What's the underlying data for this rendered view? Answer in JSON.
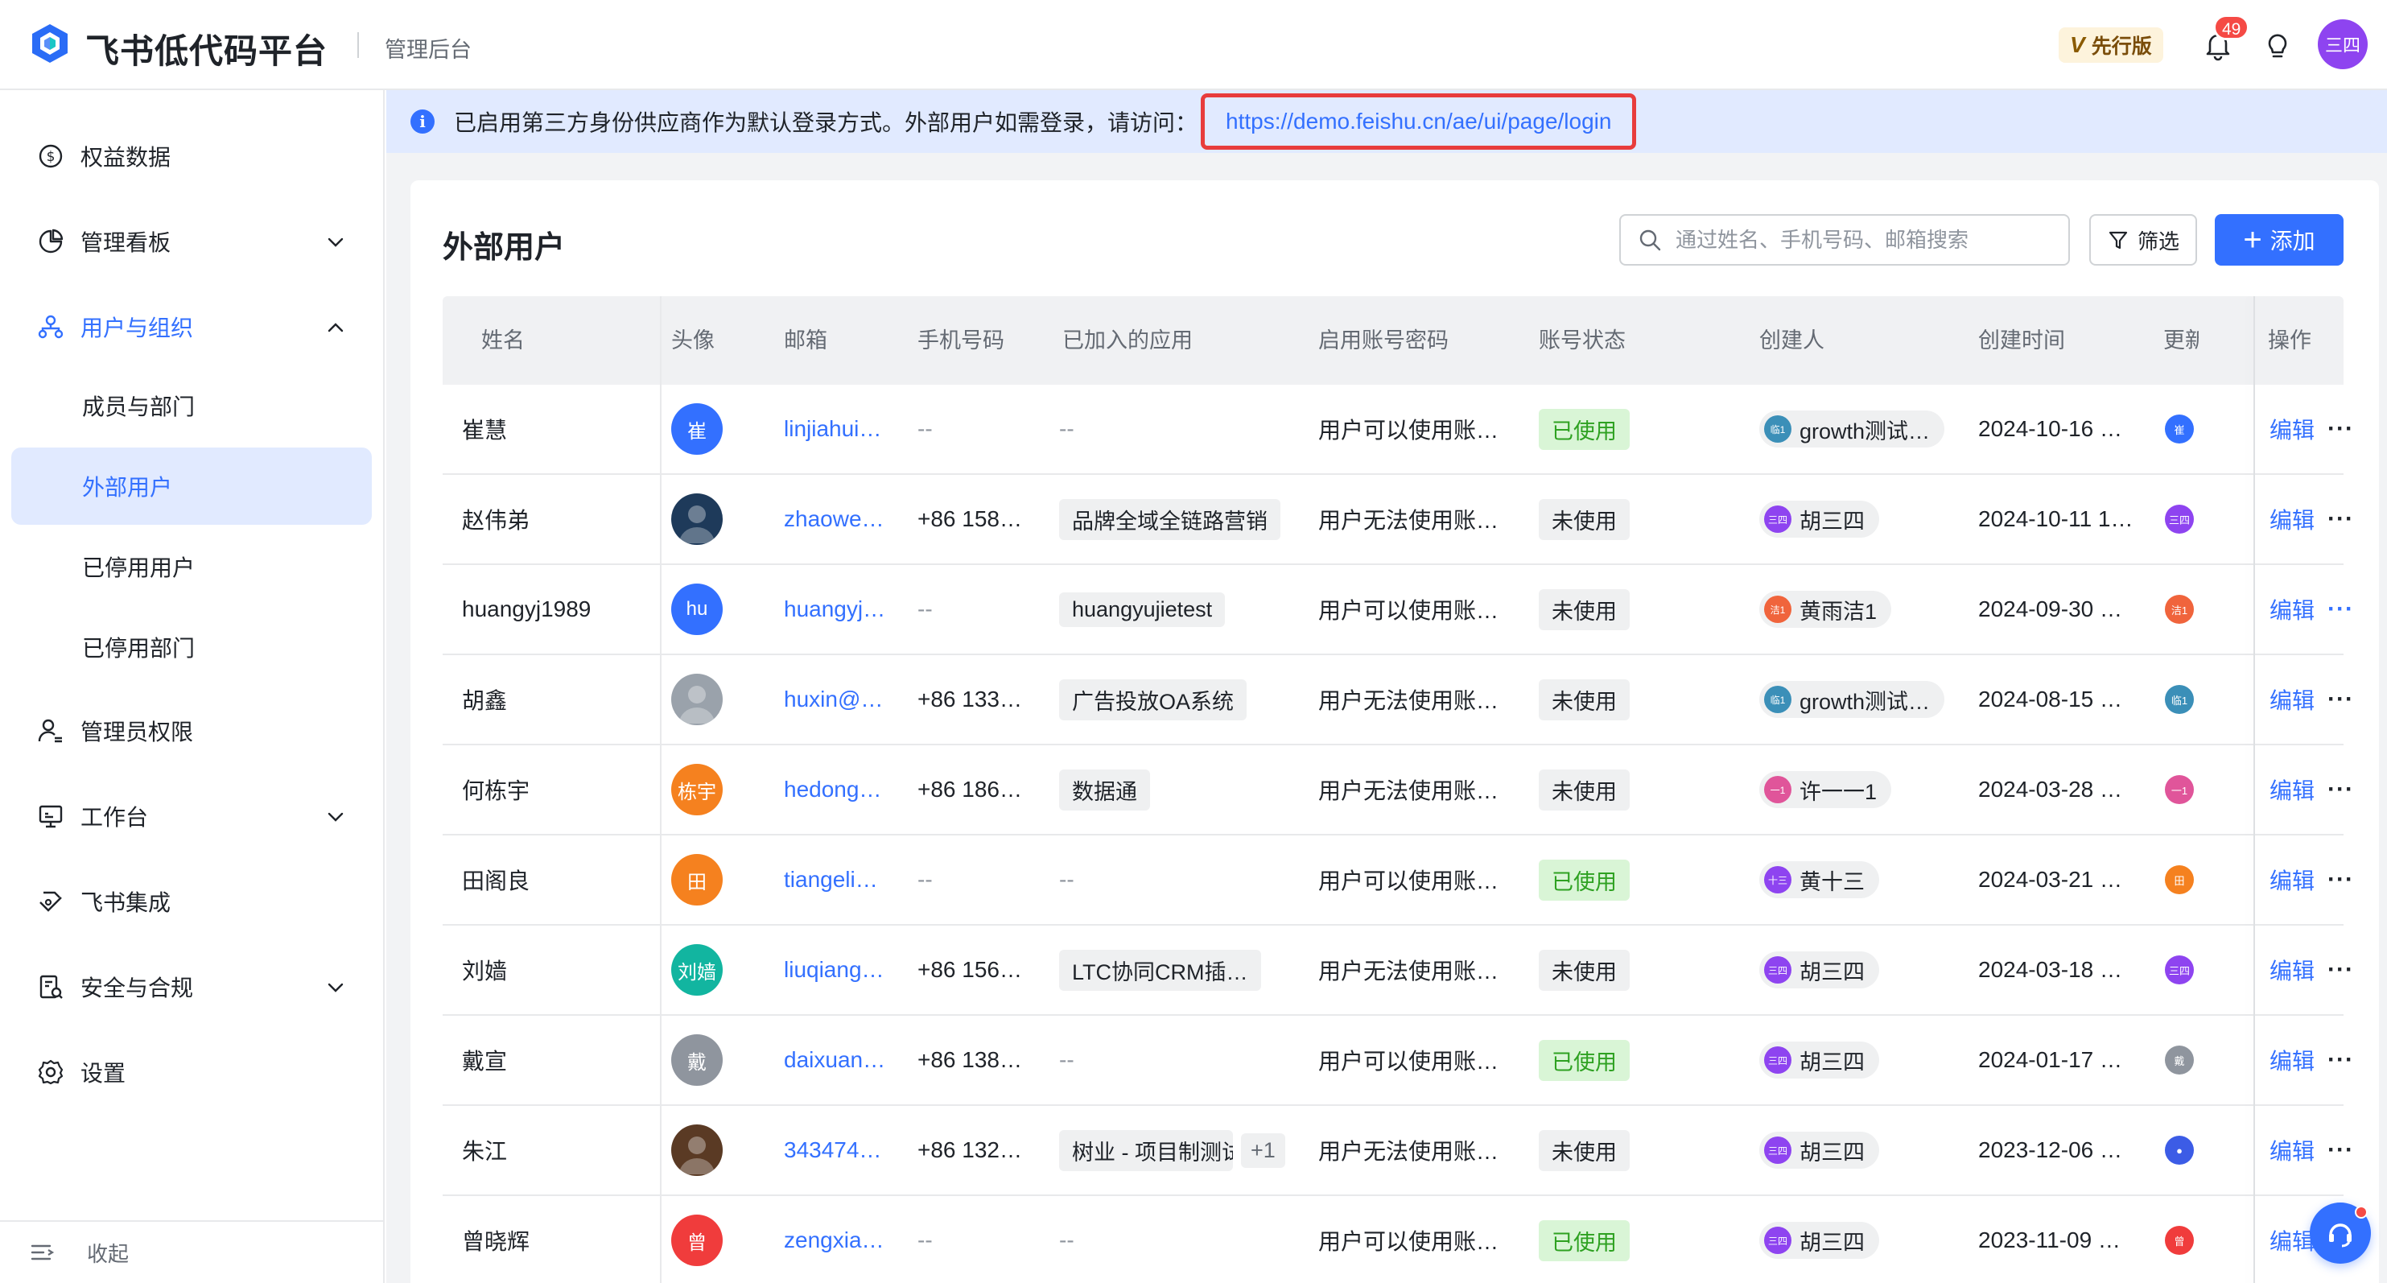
{
  "header": {
    "app_name": "飞书低代码平台",
    "console_label": "管理后台",
    "edition_mark": "V",
    "edition_label": "先行版",
    "notification_count": "49",
    "user_avatar_text": "三四"
  },
  "sidebar": {
    "items": [
      {
        "label": "权益数据",
        "icon": "dollar-circle-icon"
      },
      {
        "label": "管理看板",
        "icon": "pie-chart-icon"
      },
      {
        "label": "用户与组织",
        "icon": "org-icon"
      },
      {
        "label": "成员与部门"
      },
      {
        "label": "外部用户"
      },
      {
        "label": "已停用用户"
      },
      {
        "label": "已停用部门"
      },
      {
        "label": "管理员权限",
        "icon": "admin-user-icon"
      },
      {
        "label": "工作台",
        "icon": "workbench-icon"
      },
      {
        "label": "飞书集成",
        "icon": "integration-icon"
      },
      {
        "label": "安全与合规",
        "icon": "security-icon"
      },
      {
        "label": "设置",
        "icon": "gear-icon"
      }
    ],
    "collapse_label": "收起"
  },
  "notice": {
    "text": "已启用第三方身份供应商作为默认登录方式。外部用户如需登录，请访问：",
    "link": "https://demo.feishu.cn/ae/ui/page/login"
  },
  "page": {
    "title": "外部用户",
    "search_placeholder": "通过姓名、手机号码、邮箱搜索",
    "filter_label": "筛选",
    "add_label": "添加"
  },
  "table": {
    "columns": [
      "姓名",
      "头像",
      "邮箱",
      "手机号码",
      "已加入的应用",
      "启用账号密码",
      "账号状态",
      "创建人",
      "创建时间",
      "更新",
      "操作"
    ],
    "edit_label": "编辑",
    "more_label": "···",
    "rows": [
      {
        "name": "崔慧",
        "avatar_text": "崔",
        "avatar_color": "#3370ff",
        "email": "linjiahui…",
        "phone": "--",
        "apps": [],
        "pwd": "用户可以使用账…",
        "status": "已使用",
        "status_type": "used",
        "creator_mini": "临1",
        "creator_color": "#3b8fb8",
        "creator": "growth测试…",
        "created": "2024-10-16 …",
        "updater_text": "崔",
        "updater_color": "#3370ff",
        "more_blue": false
      },
      {
        "name": "赵伟弟",
        "avatar_text": "",
        "avatar_color": "#1e3a5a",
        "email": "zhaowe…",
        "phone": "+86 158…",
        "apps": [
          "品牌全域全链路营销"
        ],
        "pwd": "用户无法使用账…",
        "status": "未使用",
        "status_type": "unused",
        "creator_mini": "三四",
        "creator_color": "#8e44f0",
        "creator": "胡三四",
        "created": "2024-10-11 1…",
        "updater_text": "三四",
        "updater_color": "#8e44f0",
        "more_blue": false
      },
      {
        "name": "huangyj1989",
        "avatar_text": "hu",
        "avatar_color": "#3370ff",
        "email": "huangyj…",
        "phone": "--",
        "apps": [
          "huangyujietest"
        ],
        "pwd": "用户可以使用账…",
        "status": "未使用",
        "status_type": "unused",
        "creator_mini": "洁1",
        "creator_color": "#f0643c",
        "creator": "黄雨洁1",
        "created": "2024-09-30 …",
        "updater_text": "洁1",
        "updater_color": "#f0643c",
        "more_blue": true
      },
      {
        "name": "胡鑫",
        "avatar_text": "",
        "avatar_color": "#9aa2ab",
        "email": "huxin@…",
        "phone": "+86 133…",
        "apps": [
          "广告投放OA系统"
        ],
        "pwd": "用户无法使用账…",
        "status": "未使用",
        "status_type": "unused",
        "creator_mini": "临1",
        "creator_color": "#3b8fb8",
        "creator": "growth测试…",
        "created": "2024-08-15 …",
        "updater_text": "临1",
        "updater_color": "#3b8fb8",
        "more_blue": false
      },
      {
        "name": "何栋宇",
        "avatar_text": "栋宇",
        "avatar_color": "#f5811f",
        "email": "hedong…",
        "phone": "+86 186…",
        "apps": [
          "数据通"
        ],
        "pwd": "用户无法使用账…",
        "status": "未使用",
        "status_type": "unused",
        "creator_mini": "一1",
        "creator_color": "#e0559a",
        "creator": "许一一1",
        "created": "2024-03-28 …",
        "updater_text": "一1",
        "updater_color": "#e0559a",
        "more_blue": false
      },
      {
        "name": "田阁良",
        "avatar_text": "田",
        "avatar_color": "#f5811f",
        "email": "tiangeli…",
        "phone": "--",
        "apps": [],
        "pwd": "用户可以使用账…",
        "status": "已使用",
        "status_type": "used",
        "creator_mini": "十三",
        "creator_color": "#8e44f0",
        "creator": "黄十三",
        "created": "2024-03-21 …",
        "updater_text": "田",
        "updater_color": "#f5811f",
        "more_blue": false
      },
      {
        "name": "刘嫱",
        "avatar_text": "刘嫱",
        "avatar_color": "#12b5a0",
        "email": "liuqiang…",
        "phone": "+86 156…",
        "apps": [
          "LTC协同CRM插…"
        ],
        "pwd": "用户无法使用账…",
        "status": "未使用",
        "status_type": "unused",
        "creator_mini": "三四",
        "creator_color": "#8e44f0",
        "creator": "胡三四",
        "created": "2024-03-18 …",
        "updater_text": "三四",
        "updater_color": "#8e44f0",
        "more_blue": false
      },
      {
        "name": "戴宣",
        "avatar_text": "戴",
        "avatar_color": "#8f959e",
        "email": "daixuan…",
        "phone": "+86 138…",
        "apps": [],
        "pwd": "用户可以使用账…",
        "status": "已使用",
        "status_type": "used",
        "creator_mini": "三四",
        "creator_color": "#8e44f0",
        "creator": "胡三四",
        "created": "2024-01-17 …",
        "updater_text": "戴",
        "updater_color": "#8f959e",
        "more_blue": false
      },
      {
        "name": "朱江",
        "avatar_text": "",
        "avatar_color": "#5a3a24",
        "email": "343474…",
        "phone": "+86 132…",
        "apps": [
          "树业 - 项目制测试"
        ],
        "apps_more": "+1",
        "pwd": "用户无法使用账…",
        "status": "未使用",
        "status_type": "unused",
        "creator_mini": "三四",
        "creator_color": "#8e44f0",
        "creator": "胡三四",
        "created": "2023-12-06 …",
        "updater_text": "●",
        "updater_color": "#3c5ce6",
        "more_blue": false
      },
      {
        "name": "曾晓辉",
        "avatar_text": "曾",
        "avatar_color": "#f03c3c",
        "email": "zengxia…",
        "phone": "--",
        "apps": [],
        "pwd": "用户可以使用账…",
        "status": "已使用",
        "status_type": "used",
        "creator_mini": "三四",
        "creator_color": "#8e44f0",
        "creator": "胡三四",
        "created": "2023-11-09 …",
        "updater_text": "曾",
        "updater_color": "#f03c3c",
        "more_blue": false
      }
    ]
  }
}
